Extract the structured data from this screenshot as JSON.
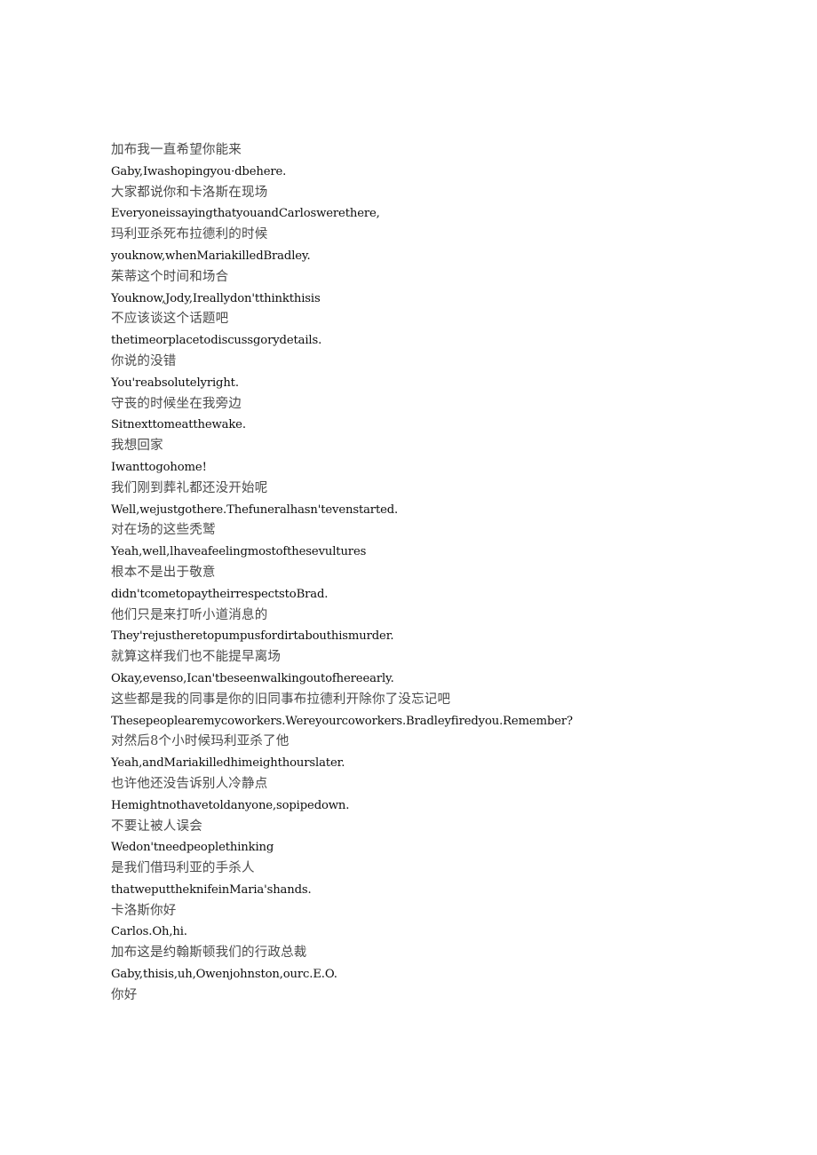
{
  "page": {
    "background_color": "#ffffff",
    "zh_text_color": "#4a4a4a",
    "en_text_color": "#0d0d0d"
  },
  "subtitles": {
    "lines": [
      {
        "lang": "zh",
        "text": "加布我一直希望你能来"
      },
      {
        "lang": "en",
        "text": "Gaby,Iwashopingyou·dbehere."
      },
      {
        "lang": "zh",
        "text": "大家都说你和卡洛斯在现场"
      },
      {
        "lang": "en",
        "text": "EveryoneissayingthatyouandCarloswerethere,"
      },
      {
        "lang": "zh",
        "text": "玛利亚杀死布拉德利的时候"
      },
      {
        "lang": "en",
        "text": "youknow,whenMariakilledBradley."
      },
      {
        "lang": "zh",
        "text": "茱蒂这个时间和场合"
      },
      {
        "lang": "en",
        "text": "Youknow,Jody,Ireallydon'tthinkthisis"
      },
      {
        "lang": "zh",
        "text": "不应该谈这个话题吧"
      },
      {
        "lang": "en",
        "text": "thetimeorplacetodiscussgorydetails."
      },
      {
        "lang": "zh",
        "text": "你说的没错"
      },
      {
        "lang": "en",
        "text": "You'reabsolutelyright."
      },
      {
        "lang": "zh",
        "text": "守丧的时候坐在我旁边"
      },
      {
        "lang": "en",
        "text": "Sitnexttomeatthewake."
      },
      {
        "lang": "zh",
        "text": "我想回家"
      },
      {
        "lang": "en",
        "text": "Iwanttogohome!"
      },
      {
        "lang": "zh",
        "text": "我们刚到葬礼都还没开始呢"
      },
      {
        "lang": "en",
        "text": "Well,wejustgothere.Thefuneralhasn'tevenstarted."
      },
      {
        "lang": "zh",
        "text": "对在场的这些秃鹫"
      },
      {
        "lang": "en",
        "text": "Yeah,well,lhaveafeelingmostofthesevultures"
      },
      {
        "lang": "zh",
        "text": "根本不是出于敬意"
      },
      {
        "lang": "en",
        "text": "didn'tcometopaytheirrespectstoBrad."
      },
      {
        "lang": "zh",
        "text": "他们只是来打听小道消息的"
      },
      {
        "lang": "en",
        "text": "They'rejustheretopumpusfordirtabouthismurder."
      },
      {
        "lang": "zh",
        "text": "就算这样我们也不能提早离场"
      },
      {
        "lang": "en",
        "text": "Okay,evenso,Ican'tbeseenwalkingoutofhereearly."
      },
      {
        "lang": "zh",
        "text": "这些都是我的同事是你的旧同事布拉德利开除你了没忘记吧"
      },
      {
        "lang": "en",
        "text": "Thesepeoplearemycoworkers.Wereyourcoworkers.Bradleyfiredyou.Remember?"
      },
      {
        "lang": "zh",
        "text": "对然后8个小时候玛利亚杀了他"
      },
      {
        "lang": "en",
        "text": "Yeah,andMariakilledhimeighthourslater."
      },
      {
        "lang": "zh",
        "text": "也许他还没告诉别人冷静点"
      },
      {
        "lang": "en",
        "text": "Hemightnothavetoldanyone,sopipedown."
      },
      {
        "lang": "zh",
        "text": "不要让被人误会"
      },
      {
        "lang": "en",
        "text": "Wedon'tneedpeoplethinking"
      },
      {
        "lang": "zh",
        "text": "是我们借玛利亚的手杀人"
      },
      {
        "lang": "en",
        "text": "thatweputtheknifeinMaria'shands."
      },
      {
        "lang": "zh",
        "text": "卡洛斯你好"
      },
      {
        "lang": "en",
        "text": "Carlos.Oh,hi."
      },
      {
        "lang": "zh",
        "text": "加布这是约翰斯顿我们的行政总裁"
      },
      {
        "lang": "en",
        "text": "Gaby,thisis,uh,Owenjohnston,ourc.E.O."
      },
      {
        "lang": "zh",
        "text": "你好"
      }
    ]
  }
}
